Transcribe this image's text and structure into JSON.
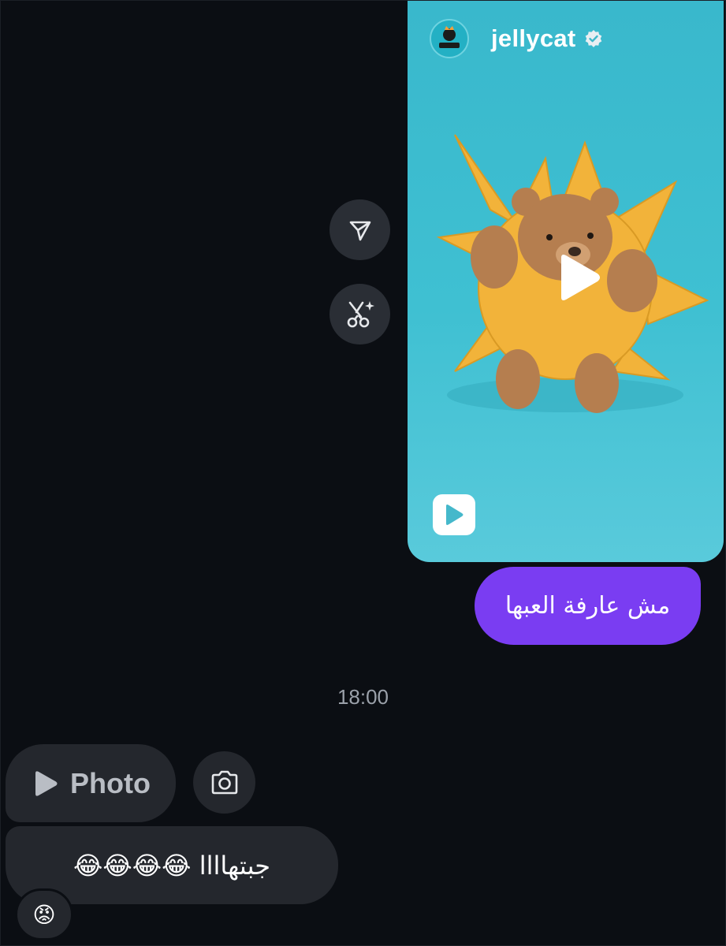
{
  "shared_reel": {
    "username": "jellycat",
    "verified": true,
    "media_type": "reel",
    "colors": {
      "background": "#3fc0d2",
      "plush": "#f2b33a",
      "bear": "#b57e4f"
    },
    "icons": {
      "play_overlay": "play-circle-icon",
      "reel_badge": "reels-icon",
      "verified": "verified-badge-icon",
      "avatar": "jellycat-logo-icon"
    }
  },
  "side_actions": [
    {
      "icon": "send-icon"
    },
    {
      "icon": "remix-icon"
    }
  ],
  "outgoing_message": {
    "text": "مش عارفة العبها",
    "color": "#7a3df2"
  },
  "timestamp": "18:00",
  "incoming": {
    "photo_bubble": {
      "label": "Photo",
      "icon": "play-icon"
    },
    "camera_button": {
      "icon": "camera-icon"
    },
    "text_message": "جبتهاااا 😂😂😂😂",
    "reaction": "😡"
  },
  "colors": {
    "background": "#0b0e13",
    "incoming_bubble": "#24272d",
    "timestamp_text": "#9ba1aa"
  }
}
